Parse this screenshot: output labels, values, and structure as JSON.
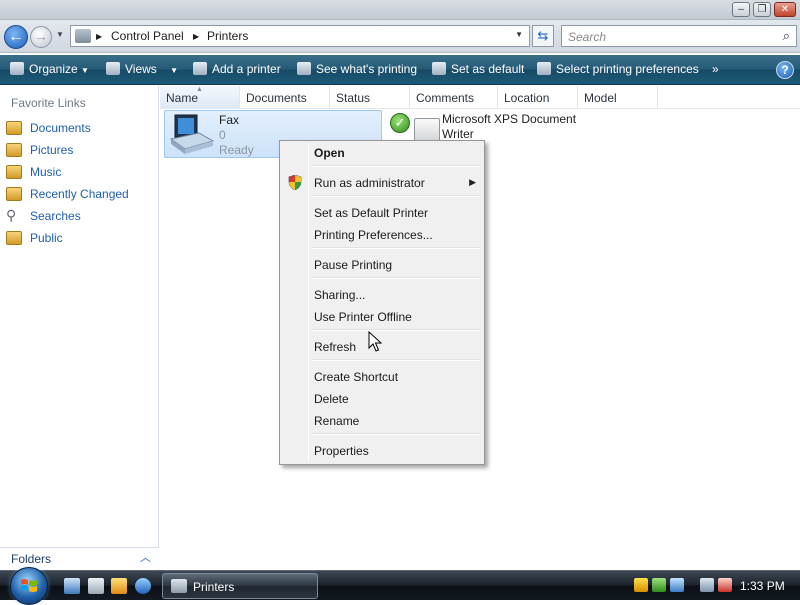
{
  "address": {
    "crumbs": [
      "Control Panel",
      "Printers"
    ]
  },
  "search": {
    "placeholder": "Search"
  },
  "command_bar": {
    "organize": "Organize",
    "views": "Views",
    "add_printer": "Add a printer",
    "see_printing": "See what's printing",
    "set_default": "Set as default",
    "select_prefs": "Select printing preferences",
    "more": "»",
    "help": "?"
  },
  "left_pane": {
    "title": "Favorite Links",
    "items": [
      {
        "label": "Documents",
        "icon": "documents-icon"
      },
      {
        "label": "Pictures",
        "icon": "pictures-icon"
      },
      {
        "label": "Music",
        "icon": "music-icon"
      },
      {
        "label": "Recently Changed",
        "icon": "recently-changed-icon"
      },
      {
        "label": "Searches",
        "icon": "searches-icon"
      },
      {
        "label": "Public",
        "icon": "public-icon"
      }
    ],
    "folders_label": "Folders"
  },
  "columns": [
    "Name",
    "Documents",
    "Status",
    "Comments",
    "Location",
    "Model"
  ],
  "items": {
    "fax": {
      "name": "Fax",
      "docs": "0",
      "status": "Ready"
    },
    "xps": {
      "name_line1": "Microsoft XPS Document",
      "name_line2": "Writer"
    }
  },
  "context_menu": {
    "open": "Open",
    "run_as_admin": "Run as administrator",
    "set_default": "Set as Default Printer",
    "printing_prefs": "Printing Preferences...",
    "pause": "Pause Printing",
    "sharing": "Sharing...",
    "offline": "Use Printer Offline",
    "refresh": "Refresh",
    "create_shortcut": "Create Shortcut",
    "delete": "Delete",
    "rename": "Rename",
    "properties": "Properties"
  },
  "taskbar": {
    "window_label": "Printers",
    "clock": "1:33 PM"
  },
  "colors": {
    "accent": "#1f5fae",
    "command_bar": "#245a76",
    "selection": "#cde2f9"
  }
}
